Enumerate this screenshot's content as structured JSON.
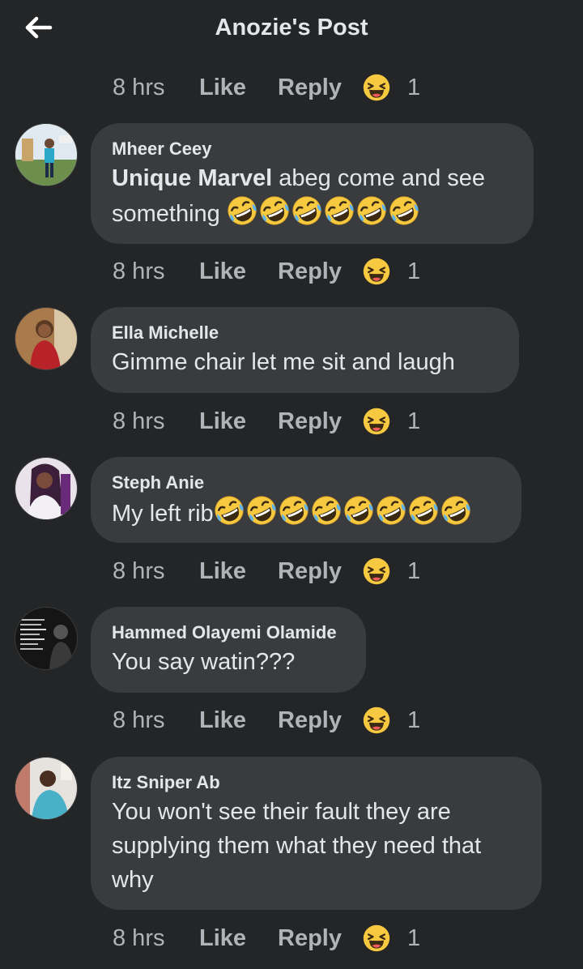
{
  "header": {
    "title": "Anozie's Post"
  },
  "top_actions": {
    "time": "8 hrs",
    "like": "Like",
    "reply": "Reply",
    "count": "1"
  },
  "comments": [
    {
      "name": "Mheer Ceey",
      "mention": "Unique Marvel",
      "text_after_mention": "abeg come and see",
      "text_line2": "something",
      "emoji_count": 6,
      "actions": {
        "time": "8 hrs",
        "like": "Like",
        "reply": "Reply",
        "count": "1"
      }
    },
    {
      "name": "Ella Michelle",
      "text": "Gimme chair let me sit and laugh",
      "actions": {
        "time": "8 hrs",
        "like": "Like",
        "reply": "Reply",
        "count": "1"
      }
    },
    {
      "name": "Steph Anie",
      "text": "My left rib",
      "emoji_count": 8,
      "actions": {
        "time": "8 hrs",
        "like": "Like",
        "reply": "Reply",
        "count": "1"
      }
    },
    {
      "name": "Hammed Olayemi Olamide",
      "text": "You say watin???",
      "actions": {
        "time": "8 hrs",
        "like": "Like",
        "reply": "Reply",
        "count": "1"
      }
    },
    {
      "name": "Itz Sniper Ab",
      "text_lines": [
        "You won't see their fault they are",
        "supplying them what they need that",
        "why"
      ],
      "actions": {
        "time": "8 hrs",
        "like": "Like",
        "reply": "Reply",
        "count": "1"
      }
    }
  ],
  "icons": {
    "back": "arrow-left-icon",
    "reaction": "haha-reaction-icon",
    "laughing": "rolling-on-floor-laughing-emoji"
  },
  "colors": {
    "background": "#242526",
    "bubble": "#3a3b3c",
    "primary_text": "#e4e6eb",
    "secondary_text": "#b0b3b8",
    "reaction_yellow": "#f7c940"
  }
}
